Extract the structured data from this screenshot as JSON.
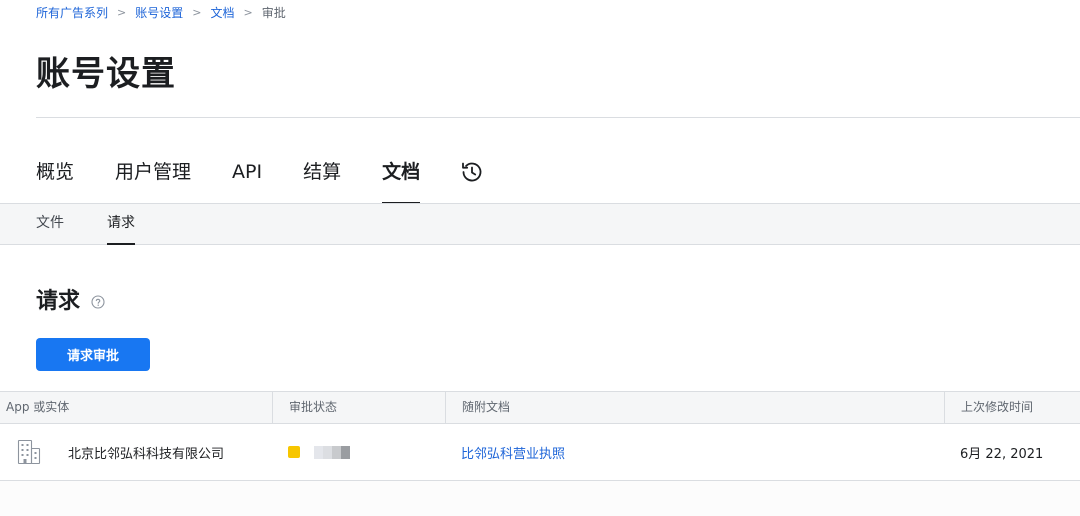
{
  "breadcrumb": {
    "items": [
      "所有广告系列",
      "账号设置",
      "文档"
    ],
    "current": "审批",
    "separator": ">"
  },
  "page": {
    "title": "账号设置"
  },
  "tabs": [
    {
      "label": "概览",
      "active": false
    },
    {
      "label": "用户管理",
      "active": false
    },
    {
      "label": "API",
      "active": false
    },
    {
      "label": "结算",
      "active": false
    },
    {
      "label": "文档",
      "active": true
    },
    {
      "icon": "history-icon",
      "active": false
    }
  ],
  "sub_tabs": [
    {
      "label": "文件",
      "active": false
    },
    {
      "label": "请求",
      "active": true
    }
  ],
  "section": {
    "title": "请求",
    "help_icon": "question-circle-icon",
    "request_button_label": "请求审批"
  },
  "table": {
    "columns": [
      "App 或实体",
      "审批状态",
      "随附文档",
      "上次修改时间"
    ],
    "rows": [
      {
        "icon": "building-icon",
        "entity": "北京比邻弘科科技有限公司",
        "status_color": "#f7c600",
        "document": "比邻弘科营业执照",
        "modified": "6月 22, 2021"
      }
    ]
  },
  "colors": {
    "accent": "#1877f2",
    "link": "#1d64d8",
    "pending": "#f7c600"
  }
}
